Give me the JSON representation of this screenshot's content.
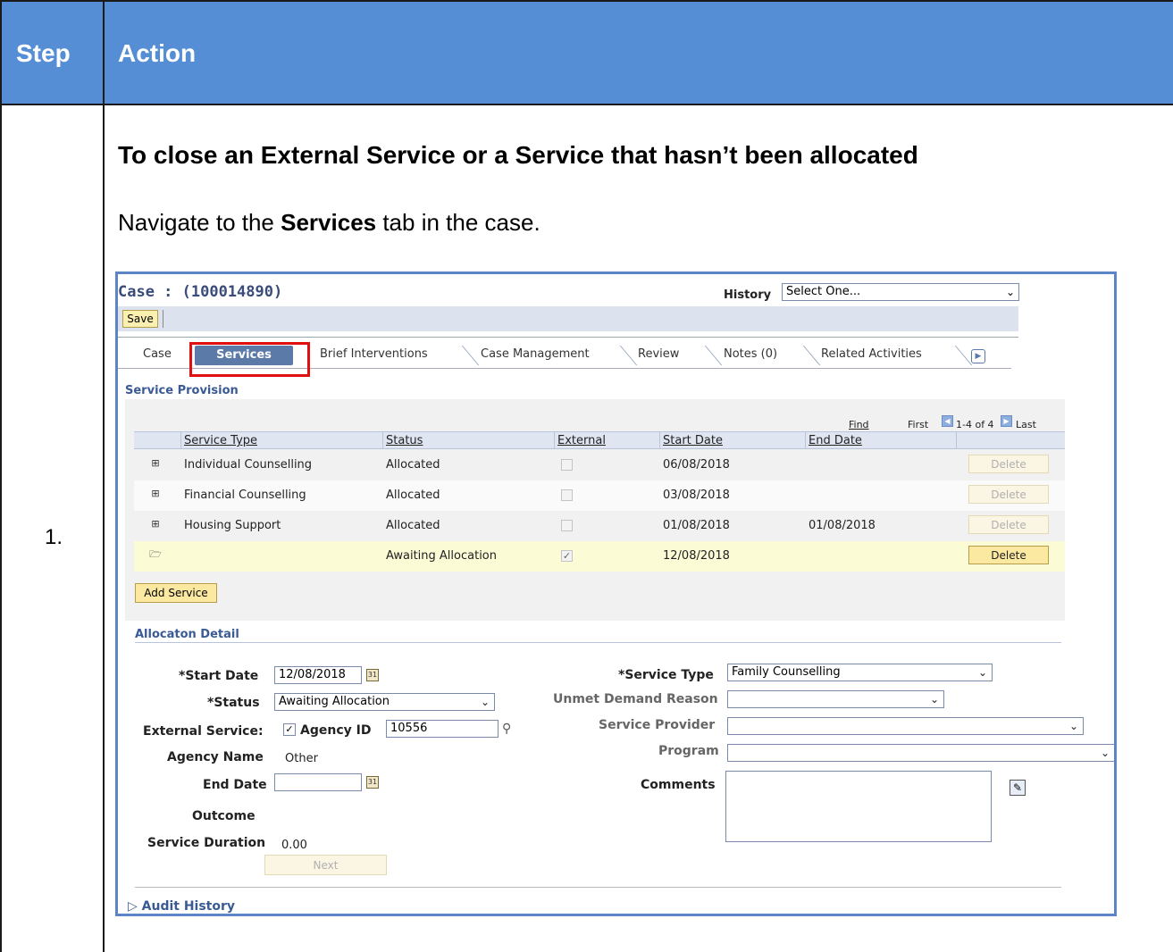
{
  "doc": {
    "header_step": "Step",
    "header_action": "Action",
    "step_number": "1.",
    "heading": "To close an External Service or a Service that hasn’t been allocated",
    "instruction_pre": "Navigate to the ",
    "instruction_bold": "Services",
    "instruction_post": " tab in the case."
  },
  "ui": {
    "case_title": "Case : (100014890)",
    "history_label": "History",
    "history_value": "Select One...",
    "save_label": "Save",
    "tabs": [
      "Case",
      "Services",
      "Brief Interventions",
      "Case Management",
      "Review",
      "Notes (0)",
      "Related Activities"
    ],
    "service_provision_label": "Service Provision",
    "nav": {
      "find": "Find",
      "first": "First",
      "count": "1-4 of 4",
      "last": "Last"
    },
    "columns": [
      "Service Type",
      "Status",
      "External",
      "Start Date",
      "End Date"
    ],
    "rows": [
      {
        "service_type": "Individual Counselling",
        "status": "Allocated",
        "external": false,
        "start_date": "06/08/2018",
        "end_date": "",
        "delete": "Delete",
        "delete_enabled": false
      },
      {
        "service_type": "Financial Counselling",
        "status": "Allocated",
        "external": false,
        "start_date": "03/08/2018",
        "end_date": "",
        "delete": "Delete",
        "delete_enabled": false
      },
      {
        "service_type": "Housing Support",
        "status": "Allocated",
        "external": false,
        "start_date": "01/08/2018",
        "end_date": "01/08/2018",
        "delete": "Delete",
        "delete_enabled": false
      },
      {
        "service_type": "",
        "status": "Awaiting Allocation",
        "external": true,
        "start_date": "12/08/2018",
        "end_date": "",
        "delete": "Delete",
        "delete_enabled": true
      }
    ],
    "add_service_label": "Add Service",
    "allocation_detail_label": "Allocaton Detail",
    "start_date_label": "*Start Date",
    "start_date_value": "12/08/2018",
    "status_label": "*Status",
    "status_value": "Awaiting Allocation",
    "external_service_label": "External Service:",
    "agency_id_label": "Agency ID",
    "agency_id_value": "10556",
    "agency_name_label": "Agency Name",
    "agency_name_value": "Other",
    "end_date_label": "End Date",
    "outcome_label": "Outcome",
    "service_duration_label": "Service Duration",
    "service_duration_value": "0.00",
    "next_label": "Next",
    "service_type_label": "*Service Type",
    "service_type_value": "Family Counselling",
    "unmet_demand_label": "Unmet Demand Reason",
    "service_provider_label": "Service Provider",
    "program_label": "Program",
    "comments_label": "Comments",
    "audit_history_label": "Audit History"
  },
  "colors": {
    "header_bg": "#558ED5",
    "highlight": "#E01010",
    "tab_active": "#5C7AA7"
  },
  "icons": [
    "expand-plus-icon",
    "folder-open-icon",
    "calendar-icon",
    "magnifier-icon",
    "edit-comment-icon",
    "tab-scroll-right-icon"
  ]
}
